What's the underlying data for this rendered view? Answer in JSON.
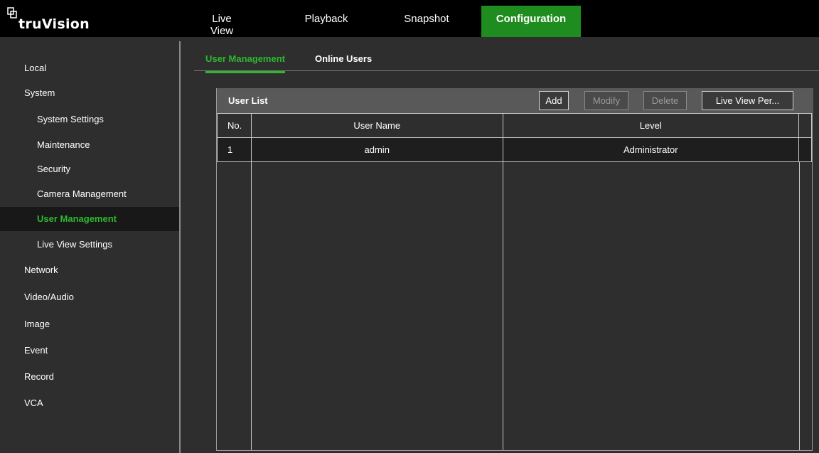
{
  "brand": {
    "logo_text": "truVision"
  },
  "nav": {
    "tabs": [
      {
        "label": "Live View"
      },
      {
        "label": "Playback"
      },
      {
        "label": "Snapshot"
      },
      {
        "label": "Configuration"
      }
    ],
    "active": "Configuration"
  },
  "sidebar": {
    "items": [
      {
        "label": "Local"
      },
      {
        "label": "System"
      },
      {
        "label": "System Settings"
      },
      {
        "label": "Maintenance"
      },
      {
        "label": "Security"
      },
      {
        "label": "Camera Management"
      },
      {
        "label": "User Management"
      },
      {
        "label": "Live View Settings"
      },
      {
        "label": "Network"
      },
      {
        "label": "Video/Audio"
      },
      {
        "label": "Image"
      },
      {
        "label": "Event"
      },
      {
        "label": "Record"
      },
      {
        "label": "VCA"
      }
    ],
    "active": "User Management"
  },
  "subtabs": {
    "items": [
      {
        "label": "User Management"
      },
      {
        "label": "Online Users"
      }
    ],
    "active": "User Management"
  },
  "panel": {
    "title": "User List",
    "buttons": {
      "add": "Add",
      "modify": "Modify",
      "delete": "Delete",
      "live_view": "Live View Per..."
    },
    "columns": [
      "No.",
      "User Name",
      "Level"
    ],
    "rows": [
      {
        "no": "1",
        "user_name": "admin",
        "level": "Administrator"
      }
    ]
  },
  "colors": {
    "accent": "#1e8c1e",
    "accent_text": "#2eb82e",
    "background": "#2e2e2e",
    "topbar": "#000000"
  }
}
